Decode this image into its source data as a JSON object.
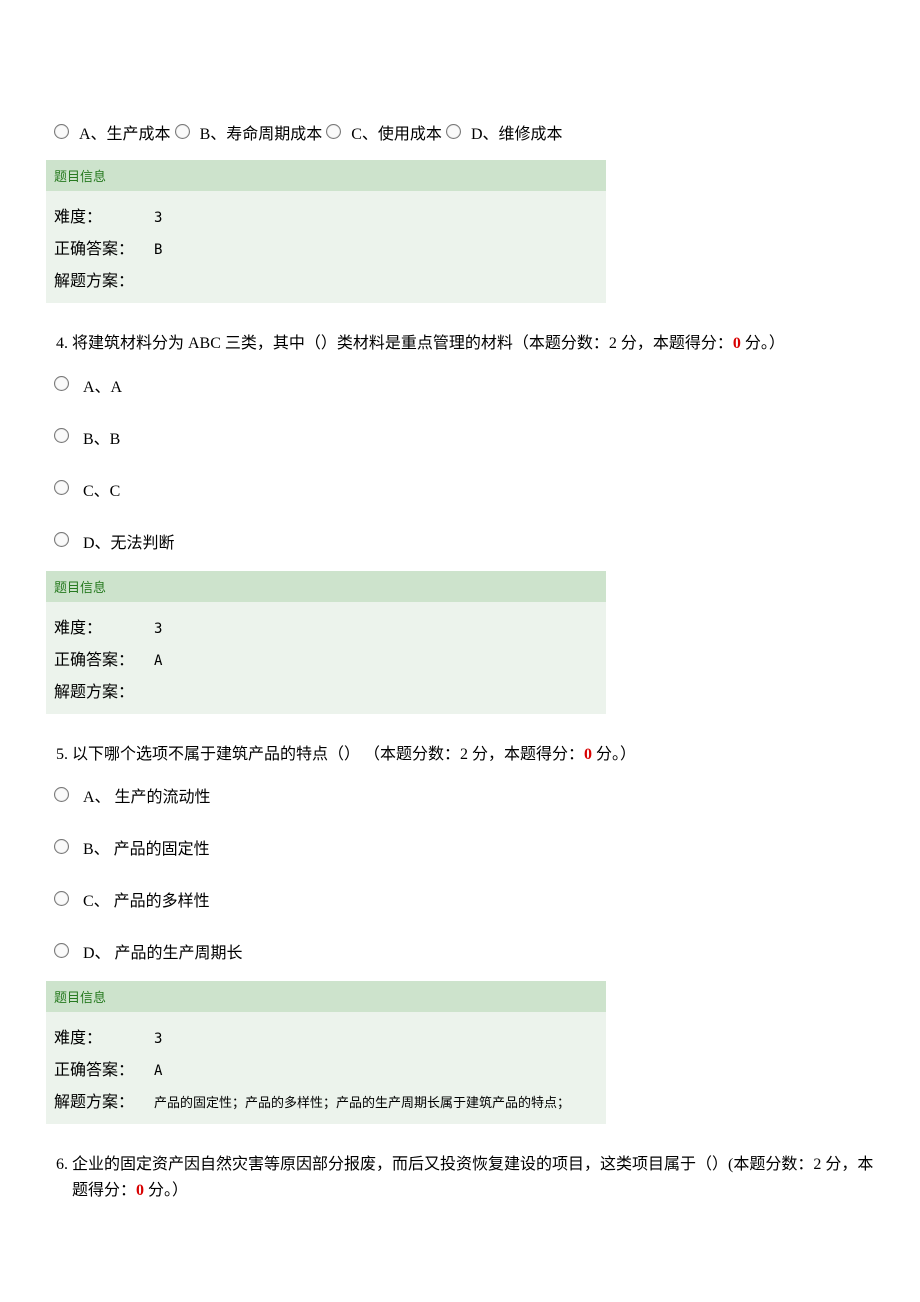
{
  "labels": {
    "info_header": "题目信息",
    "difficulty": "难度：",
    "correct": "正确答案：",
    "solution": "解题方案："
  },
  "q3": {
    "options": {
      "a": "A、生产成本",
      "b": "B、寿命周期成本",
      "c": "C、使用成本",
      "d": "D、维修成本"
    },
    "difficulty": "3",
    "answer": "B",
    "solution": ""
  },
  "q4": {
    "number": "4.",
    "stem_pre": "将建筑材料分为 ABC 三类，其中（）类材料是重点管理的材料（本题分数：2 分，本题得分：",
    "score": "0",
    "stem_post": " 分。）",
    "options": {
      "a": "A、A",
      "b": "B、B",
      "c": "C、C",
      "d": "D、无法判断"
    },
    "difficulty": "3",
    "answer": "A",
    "solution": ""
  },
  "q5": {
    "number": "5.",
    "stem_pre": "以下哪个选项不属于建筑产品的特点（） （本题分数：2 分，本题得分：",
    "score": "0",
    "stem_post": " 分。）",
    "options": {
      "a": "A、 生产的流动性",
      "b": "B、 产品的固定性",
      "c": "C、 产品的多样性",
      "d": "D、 产品的生产周期长"
    },
    "difficulty": "3",
    "answer": "A",
    "solution": "产品的固定性；产品的多样性；产品的生产周期长属于建筑产品的特点；"
  },
  "q6": {
    "number": "6.",
    "stem_pre": "企业的固定资产因自然灾害等原因部分报废，而后又投资恢复建设的项目，这类项目属于（）(本题分数：2 分，本题得分：",
    "score": "0",
    "stem_post": " 分。）"
  }
}
